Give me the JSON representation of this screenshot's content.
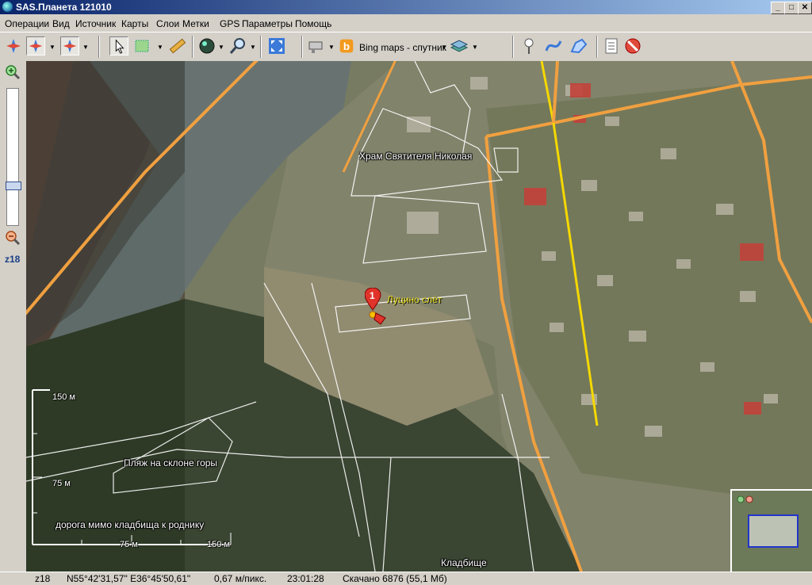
{
  "window": {
    "title": "SAS.Планета 121010",
    "min": "_",
    "max": "□",
    "close": "✕"
  },
  "menu": [
    "Операции",
    "Вид",
    "Источник",
    "Карты",
    "Слои",
    "Метки",
    "GPS",
    "Параметры",
    "Помощь"
  ],
  "toolbar": {
    "map_type": "Bing maps - спутник"
  },
  "sidebar": {
    "zoom_label": "z18"
  },
  "map": {
    "labels": {
      "church": "Храм Святителя Николая",
      "marker_name": "Луцино слёт",
      "marker_number": "1",
      "beach": "Пляж на склоне горы",
      "road": "дорога мимо кладбища к роднику",
      "cemetery": "Кладбище"
    },
    "scale": {
      "v_top": "150 м",
      "v_mid": "75 м",
      "h_mid": "75 м",
      "h_end": "150 м"
    }
  },
  "status": {
    "zoom": "z18",
    "coords": "N55°42'31,57\" E36°45'50,61\"",
    "resolution": "0,67 м/пикс.",
    "time": "23:01:28",
    "downloaded": "Скачано 6876 (55,1 Мб)"
  },
  "colors": {
    "road_orange": "#f0a040",
    "road_yellow": "#f5d800",
    "polygon": "#ffffff",
    "marker_red": "#e0342a",
    "title_blue": "#0a246a"
  }
}
